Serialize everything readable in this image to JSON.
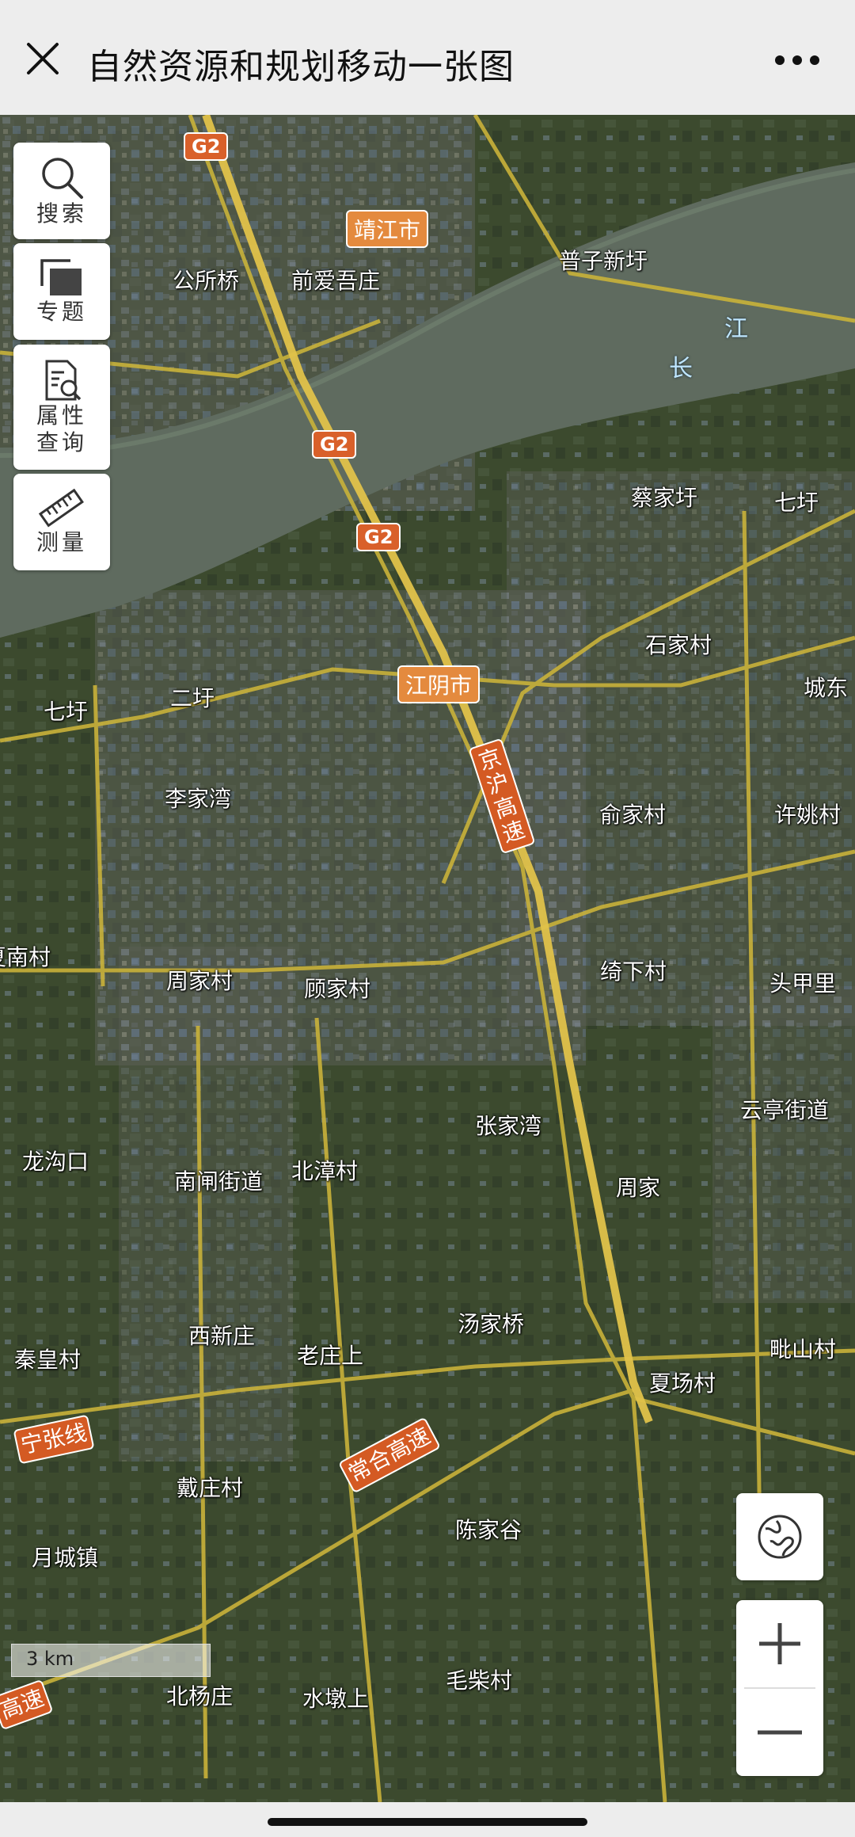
{
  "header": {
    "title": "自然资源和规划移动一张图"
  },
  "tools": [
    {
      "label": "搜索",
      "icon": "search-icon"
    },
    {
      "label": "专题",
      "icon": "layers-icon"
    },
    {
      "label": "属性\n查询",
      "icon": "document-search-icon"
    },
    {
      "label": "测量",
      "icon": "ruler-icon"
    }
  ],
  "map": {
    "places": [
      "公所桥",
      "前爱吾庄",
      "普子新圩",
      "蔡家圩",
      "七圩",
      "石家村",
      "城东",
      "七圩",
      "二圩",
      "李家湾",
      "俞家村",
      "许姚村",
      "夏南村",
      "周家村",
      "顾家村",
      "绮下村",
      "头甲里",
      "云亭街道",
      "张家湾",
      "龙沟口",
      "南闸街道",
      "北漳村",
      "周家",
      "汤家桥",
      "西新庄",
      "老庄上",
      "秦皇村",
      "夏场村",
      "毗山村",
      "戴庄村",
      "陈家谷",
      "月城镇",
      "北杨庄",
      "水墩上",
      "毛柴村"
    ],
    "cities": [
      "靖江市",
      "江阴市"
    ],
    "river_chars": [
      "江",
      "长"
    ],
    "shields": [
      "G2",
      "G2",
      "G2"
    ],
    "highways": [
      "京沪高速",
      "常合高速",
      "宁张线",
      "高速"
    ],
    "scale": "3 km",
    "colors": {
      "water": "#5c6b5f",
      "land": "#3d4a30",
      "road": "#c9b23a",
      "city_label": "#e48a3e"
    }
  }
}
